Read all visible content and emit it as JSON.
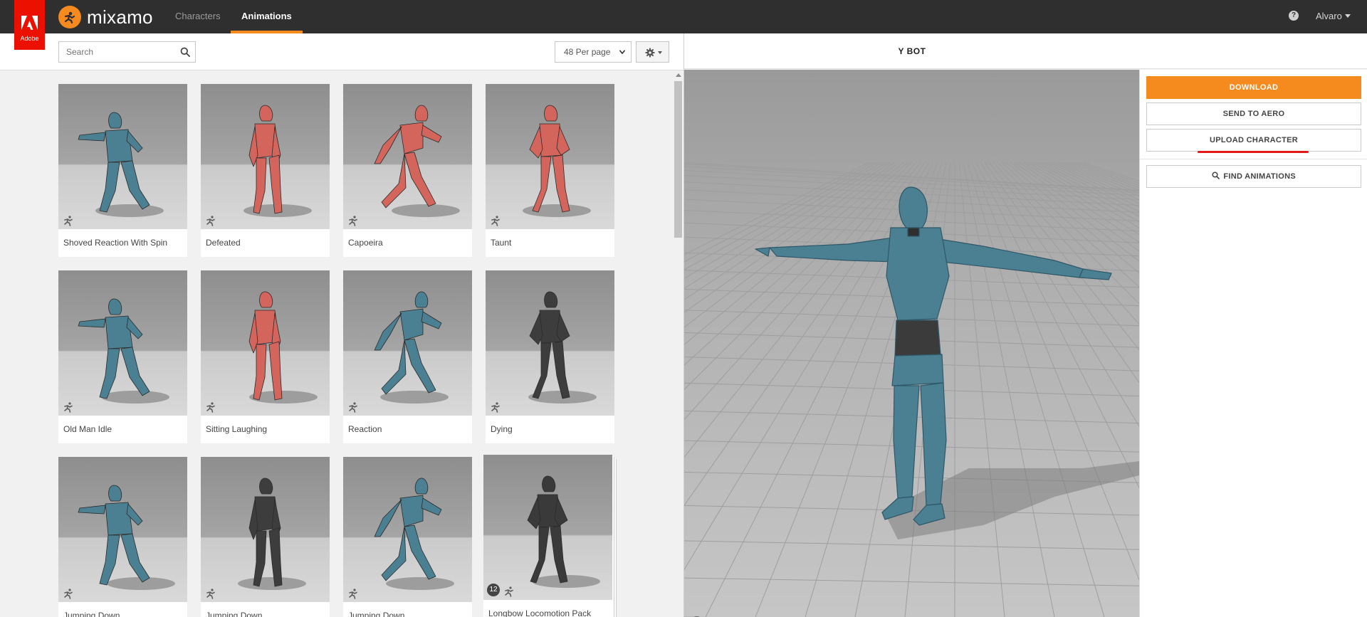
{
  "brand": {
    "adobe_label": "Adobe",
    "name": "mixamo"
  },
  "nav": {
    "tabs": [
      {
        "label": "Characters"
      },
      {
        "label": "Animations"
      }
    ],
    "active": "Animations"
  },
  "user": {
    "name": "Alvaro",
    "help_icon": "question-icon"
  },
  "toolbar": {
    "search_placeholder": "Search",
    "per_page": "48 Per page",
    "settings_icon": "gear-icon"
  },
  "animations": [
    {
      "label": "Shoved Reaction With Spin",
      "model": "ybot",
      "color": "#4b7f92"
    },
    {
      "label": "Defeated",
      "model": "xbot",
      "color": "#d4655c"
    },
    {
      "label": "Capoeira",
      "model": "xbot",
      "color": "#d4655c"
    },
    {
      "label": "Taunt",
      "model": "xbot",
      "color": "#d4655c"
    },
    {
      "label": "Old Man Idle",
      "model": "ybot",
      "color": "#4b7f92"
    },
    {
      "label": "Sitting Laughing",
      "model": "xbot",
      "color": "#d4655c"
    },
    {
      "label": "Reaction",
      "model": "ybot",
      "color": "#4b7f92"
    },
    {
      "label": "Dying",
      "model": "soldier",
      "color": "#3d3d3d"
    },
    {
      "label": "Jumping Down",
      "model": "ybot",
      "color": "#4b7f92"
    },
    {
      "label": "Jumping Down",
      "model": "soldier",
      "color": "#3d3d3d"
    },
    {
      "label": "Jumping Down",
      "model": "ybot",
      "color": "#4b7f92"
    },
    {
      "label": "Longbow Locomotion Pack",
      "model": "archer",
      "color": "#3a3a3a",
      "pack_count": "12"
    }
  ],
  "viewer": {
    "character_name": "Y BOT",
    "tools": [
      "skull-icon",
      "rotate-icon",
      "move-icon",
      "zoom-icon"
    ]
  },
  "actions": {
    "download": "DOWNLOAD",
    "send_to_aero": "SEND TO AERO",
    "upload_character": "UPLOAD CHARACTER",
    "find_animations": "FIND ANIMATIONS"
  },
  "colors": {
    "accent": "#f58a1f",
    "adobe_red": "#eb1000",
    "topbar": "#2f2f2f",
    "ybot_blue": "#4b7f92",
    "xbot_red": "#d4655c"
  }
}
